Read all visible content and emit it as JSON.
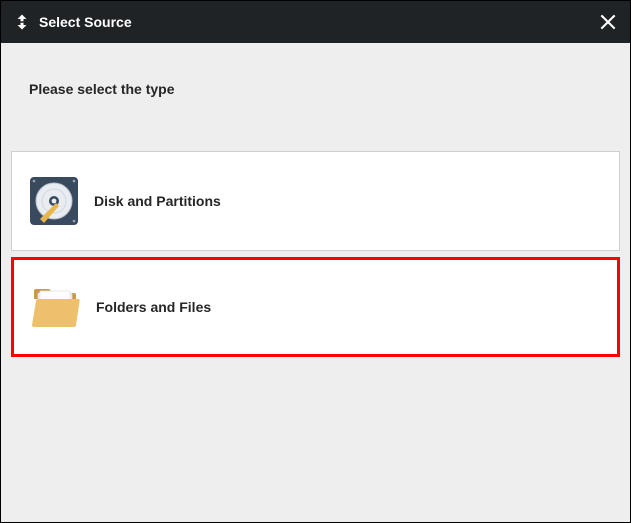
{
  "titlebar": {
    "title": "Select Source"
  },
  "content": {
    "prompt": "Please select the type"
  },
  "options": [
    {
      "label": "Disk and Partitions"
    },
    {
      "label": "Folders and Files"
    }
  ]
}
